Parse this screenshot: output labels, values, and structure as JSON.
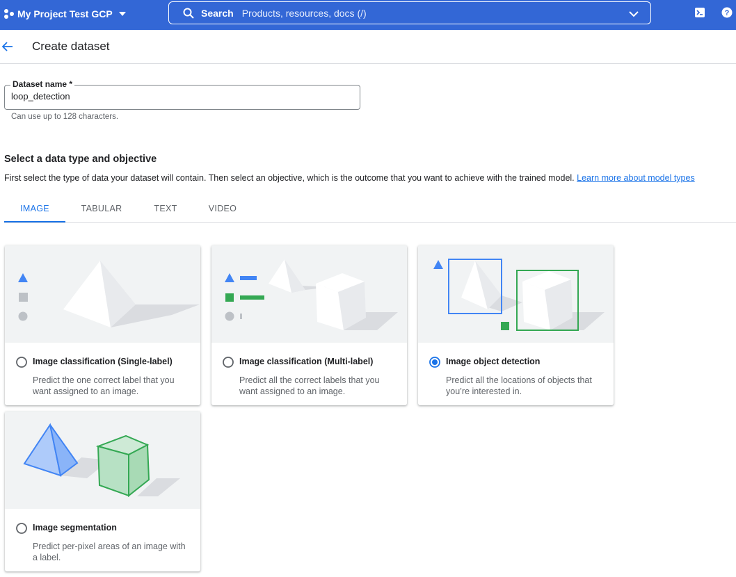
{
  "topbar": {
    "project_name": "My Project Test GCP",
    "search_label": "Search",
    "search_placeholder": "Products, resources, docs (/)",
    "colors": {
      "background": "#3367d6"
    }
  },
  "header": {
    "title": "Create dataset"
  },
  "dataset_name": {
    "label": "Dataset name *",
    "value": "loop_detection",
    "helper": "Can use up to 128 characters."
  },
  "section": {
    "title": "Select a data type and objective",
    "description": "First select the type of data your dataset will contain. Then select an objective, which is the outcome that you want to achieve with the trained model.",
    "link": "Learn more about model types"
  },
  "tabs": [
    {
      "label": "IMAGE",
      "active": true
    },
    {
      "label": "TABULAR",
      "active": false
    },
    {
      "label": "TEXT",
      "active": false
    },
    {
      "label": "VIDEO",
      "active": false
    }
  ],
  "objectives": [
    {
      "title": "Image classification (Single-label)",
      "description": "Predict the one correct label that you want assigned to an image.",
      "selected": false
    },
    {
      "title": "Image classification (Multi-label)",
      "description": "Predict all the correct labels that you want assigned to an image.",
      "selected": false
    },
    {
      "title": "Image object detection",
      "description": "Predict all the locations of objects that you’re interested in.",
      "selected": true
    },
    {
      "title": "Image segmentation",
      "description": "Predict per-pixel areas of an image with a label.",
      "selected": false
    }
  ],
  "colors": {
    "accent": "#1a73e8",
    "shape_blue": "#4285f4",
    "shape_green": "#34a853",
    "shape_gray": "#bdc1c6"
  }
}
